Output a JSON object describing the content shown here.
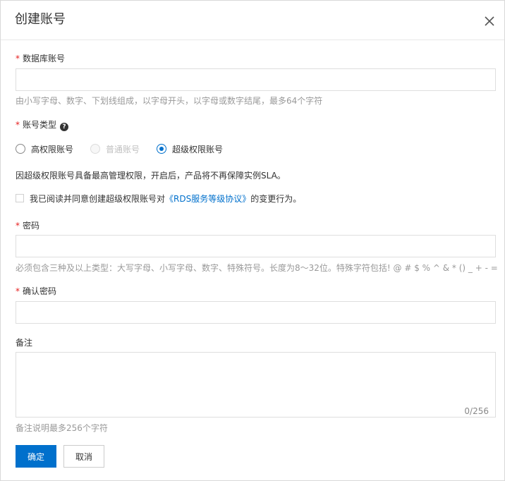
{
  "dialog": {
    "title": "创建账号"
  },
  "fields": {
    "db_account": {
      "required_mark": "*",
      "label": "数据库账号",
      "value": "",
      "hint": "由小写字母、数字、下划线组成，以字母开头，以字母或数字结尾，最多64个字符"
    },
    "account_type": {
      "required_mark": "*",
      "label": "账号类型",
      "help_icon_glyph": "?",
      "options": [
        {
          "label": "高权限账号",
          "state": "unchecked"
        },
        {
          "label": "普通账号",
          "state": "disabled"
        },
        {
          "label": "超级权限账号",
          "state": "checked"
        }
      ],
      "warning": "因超级权限账号具备最高管理权限，开启后，产品将不再保障实例SLA。",
      "agree_prefix": "我已阅读并同意创建超级权限账号对",
      "agree_link": "《RDS服务等级协议》",
      "agree_suffix": "的变更行为。"
    },
    "password": {
      "required_mark": "*",
      "label": "密码",
      "value": "",
      "hint": "必须包含三种及以上类型：大写字母、小写字母、数字、特殊符号。长度为8～32位。特殊字符包括! @ # $ % ^ & * () _ + - ="
    },
    "confirm_password": {
      "required_mark": "*",
      "label": "确认密码",
      "value": ""
    },
    "remark": {
      "label": "备注",
      "value": "",
      "counter": "0/256",
      "hint": "备注说明最多256个字符"
    }
  },
  "buttons": {
    "confirm": "确定",
    "cancel": "取消"
  },
  "colors": {
    "primary": "#0070cc",
    "required": "#e62020",
    "hint": "#999999"
  }
}
